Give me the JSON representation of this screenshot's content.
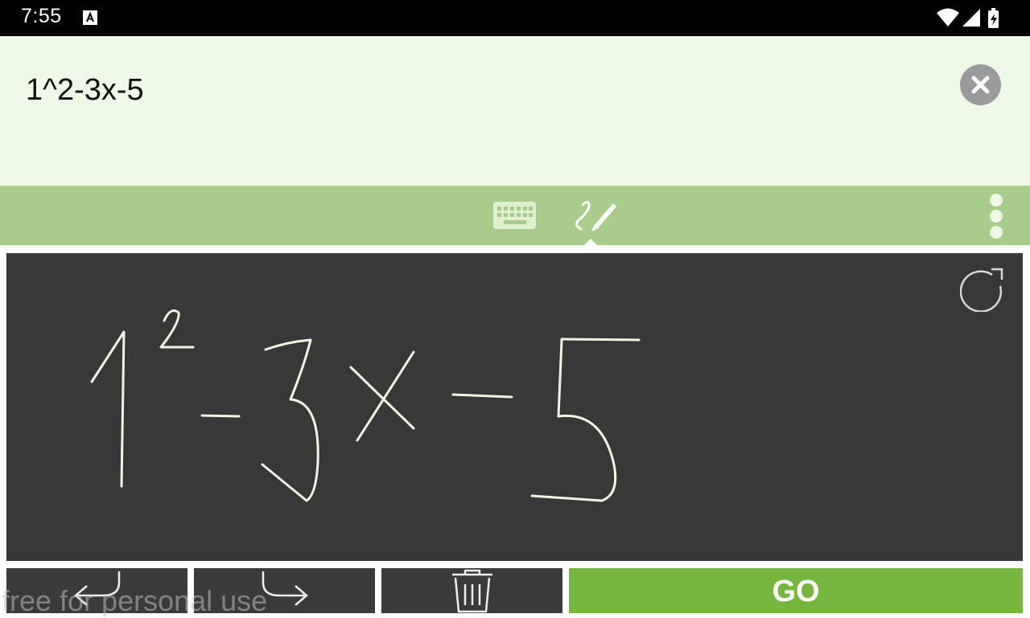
{
  "status_bar": {
    "time": "7:55",
    "icons": [
      "a-notification-icon",
      "wifi-icon",
      "cell-signal-icon",
      "battery-charging-icon"
    ]
  },
  "input": {
    "expression": "1^2-3x-5"
  },
  "mode_bar": {
    "tabs": [
      "keyboard-icon",
      "handwriting-pen-icon"
    ],
    "active_tab": "handwriting"
  },
  "toolbar": {
    "go_label": "GO"
  },
  "watermark": "free for personal use",
  "colors": {
    "input_bg": "#eef8e6",
    "mode_bar_bg": "#a8cc8b",
    "canvas_bg": "#383838",
    "go_bg": "#76b53e",
    "ink": "#f4f4e4"
  }
}
